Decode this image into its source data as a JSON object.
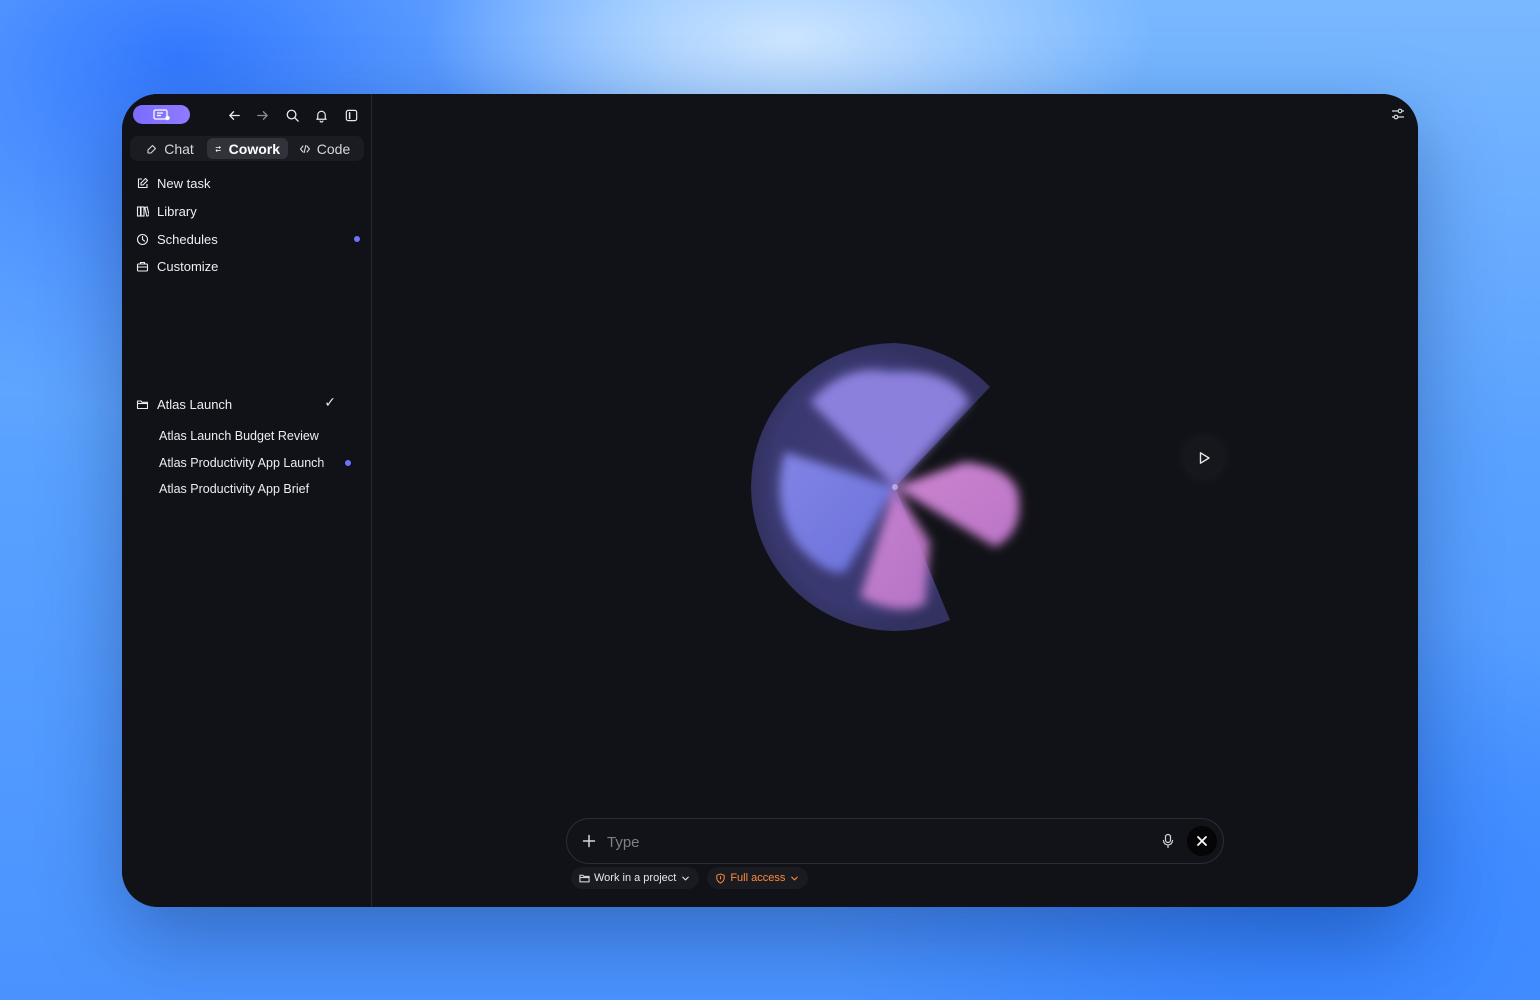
{
  "sidebar": {
    "modes": [
      {
        "label": "Chat",
        "icon": "chat-bubble-icon"
      },
      {
        "label": "Cowork",
        "icon": "cowork-icon",
        "active": true
      },
      {
        "label": "Code",
        "icon": "code-icon"
      }
    ],
    "menu": [
      {
        "label": "New task",
        "icon": "edit-icon"
      },
      {
        "label": "Library",
        "icon": "library-icon"
      },
      {
        "label": "Schedules",
        "icon": "clock-icon",
        "indicator": true
      },
      {
        "label": "Customize",
        "icon": "briefcase-icon"
      }
    ],
    "project": {
      "name": "Atlas Launch",
      "icon": "folder-icon",
      "tasks": [
        {
          "label": "Atlas Launch Budget Review"
        },
        {
          "label": "Atlas Productivity App Launch",
          "indicator": true
        },
        {
          "label": "Atlas Productivity App Brief"
        }
      ]
    }
  },
  "composer": {
    "placeholder": "Type",
    "chips": [
      {
        "label": "Work in a project",
        "icon": "folder-icon"
      },
      {
        "label": "Full access",
        "icon": "shield-icon",
        "color": "#ff8a3d"
      }
    ]
  },
  "colors": {
    "accent": "#7a6cff",
    "indicator": "#6d74ff",
    "warning": "#ff8a3d",
    "background": "#111217"
  }
}
